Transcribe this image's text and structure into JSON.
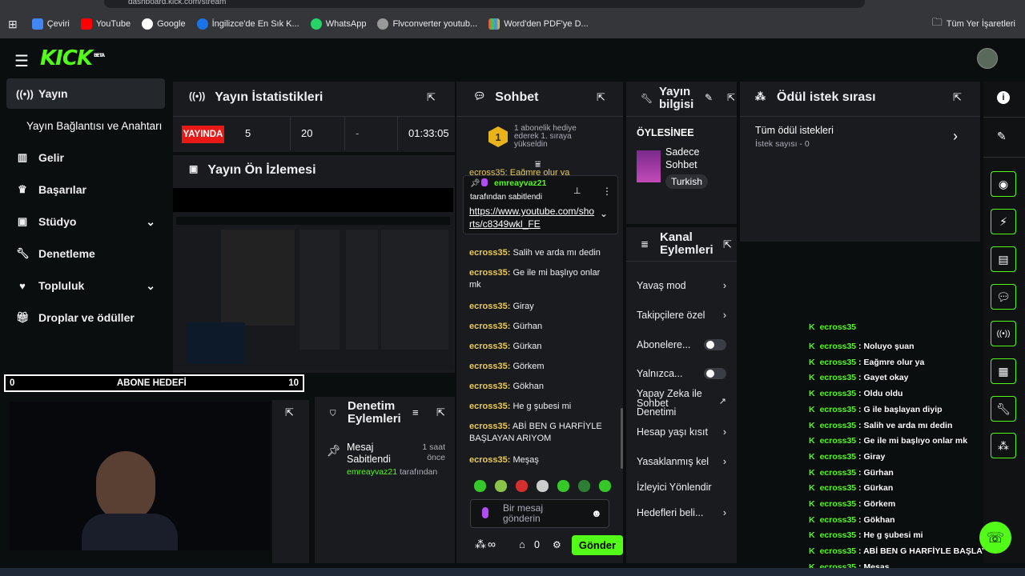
{
  "browser": {
    "url": "dashboard.kick.com/stream",
    "bookmarks": [
      "Çeviri",
      "YouTube",
      "Google",
      "İngilizce'de En Sık K...",
      "WhatsApp",
      "Flvconverter youtub...",
      "Word'den PDF'ye D..."
    ],
    "all_bookmarks": "Tüm Yer İşaretleri"
  },
  "brand": {
    "logo": "KICK",
    "beta": "BETA"
  },
  "nav": {
    "items": [
      "Yayın",
      "Yayın Bağlantısı ve Anahtarı",
      "Gelir",
      "Başarılar",
      "Stüdyo",
      "Denetleme",
      "Topluluk",
      "Droplar ve ödüller"
    ]
  },
  "stats": {
    "title": "Yayın İstatistikleri",
    "live": "YAYINDA",
    "viewers": "5",
    "followers": "20",
    "dash": "-",
    "duration": "01:33:05"
  },
  "preview": {
    "title": "Yayın Ön İzlemesi"
  },
  "goal": {
    "start": "0",
    "label": "ABONE HEDEFİ",
    "end": "10"
  },
  "moderation": {
    "title": "Denetim Eylemleri",
    "item_title": "Mesaj Sabitlendi",
    "item_time": "1 saat önce",
    "item_user": "emreayvaz21",
    "item_suffix": "tarafından"
  },
  "chat": {
    "title": "Sohbet",
    "gift_text": "1 abonelik hediye ederek 1. sıraya yükseldin",
    "gift_rank": "1",
    "pinned_user": "emreayvaz21",
    "pinned_by": "tarafından sabitlendi",
    "pinned_link": "https://www.youtube.com/shorts/c8349wkl_FE",
    "partial_top": "ecross35: Eağmre olur ya",
    "messages": [
      {
        "user": "ecross35:",
        "text": "Salih ve arda mı dedin"
      },
      {
        "user": "ecross35:",
        "text": "Ge ile mi başlıyo onlar mk"
      },
      {
        "user": "ecross35:",
        "text": "Giray"
      },
      {
        "user": "ecross35:",
        "text": "Gürhan"
      },
      {
        "user": "ecross35:",
        "text": "Gürkan"
      },
      {
        "user": "ecross35:",
        "text": "Görkem"
      },
      {
        "user": "ecross35:",
        "text": "Gökhan"
      },
      {
        "user": "ecross35:",
        "text": "He g şubesi mi"
      },
      {
        "user": "ecross35:",
        "text": "ABİ BEN G HARFİYLE BAŞLAYAN ARIYOM"
      },
      {
        "user": "ecross35:",
        "text": "Meşaş"
      }
    ],
    "input_placeholder": "Bir mesaj gönderin",
    "infinity": "∞",
    "count": "0",
    "send": "Gönder"
  },
  "stream_info": {
    "title": "Yayın bilgisi",
    "stream_title": "ÖYLESİNEE",
    "category": "Sadece Sohbet",
    "language": "Turkish"
  },
  "channel_actions": {
    "title": "Kanal Eylemleri",
    "items": [
      "Yavaş mod",
      "Takipçilere özel",
      "Abonelere...",
      "Yalnızca...",
      "Yapay Zeka ile Sohbet Denetimi",
      "Hesap yaşı kısıt",
      "Yasaklanmış kel",
      "İzleyici Yönlendir",
      "Hedefleri beli..."
    ]
  },
  "rewards": {
    "title": "Ödül istek sırası",
    "all": "Tüm ödül istekleri",
    "count": "İstek sayısı - 0"
  },
  "overlay_chat": [
    {
      "user": "ecross35",
      "text": "Noluyo şuan"
    },
    {
      "user": "ecross35",
      "text": "Eağmre olur ya"
    },
    {
      "user": "ecross35",
      "text": "Gayet okay"
    },
    {
      "user": "ecross35",
      "text": "Oldu oldu"
    },
    {
      "user": "ecross35",
      "text": "G ile başlayan diyip"
    },
    {
      "user": "ecross35",
      "text": "Salih ve arda mı dedin"
    },
    {
      "user": "ecross35",
      "text": "Ge ile mi başlıyo onlar mk"
    },
    {
      "user": "ecross35",
      "text": "Giray"
    },
    {
      "user": "ecross35",
      "text": "Gürhan"
    },
    {
      "user": "ecross35",
      "text": "Gürkan"
    },
    {
      "user": "ecross35",
      "text": "Görkem"
    },
    {
      "user": "ecross35",
      "text": "Gökhan"
    },
    {
      "user": "ecross35",
      "text": "He g şubesi mi"
    },
    {
      "user": "ecross35",
      "text": "ABİ BEN G HARFİYLE BAŞLAYAN ARIYOM"
    },
    {
      "user": "ecross35",
      "text": "Meşaş"
    }
  ],
  "colors": {
    "accent": "#53fc18",
    "live": "#e91916",
    "panel": "#191b1f",
    "username": "#e9cb53"
  }
}
